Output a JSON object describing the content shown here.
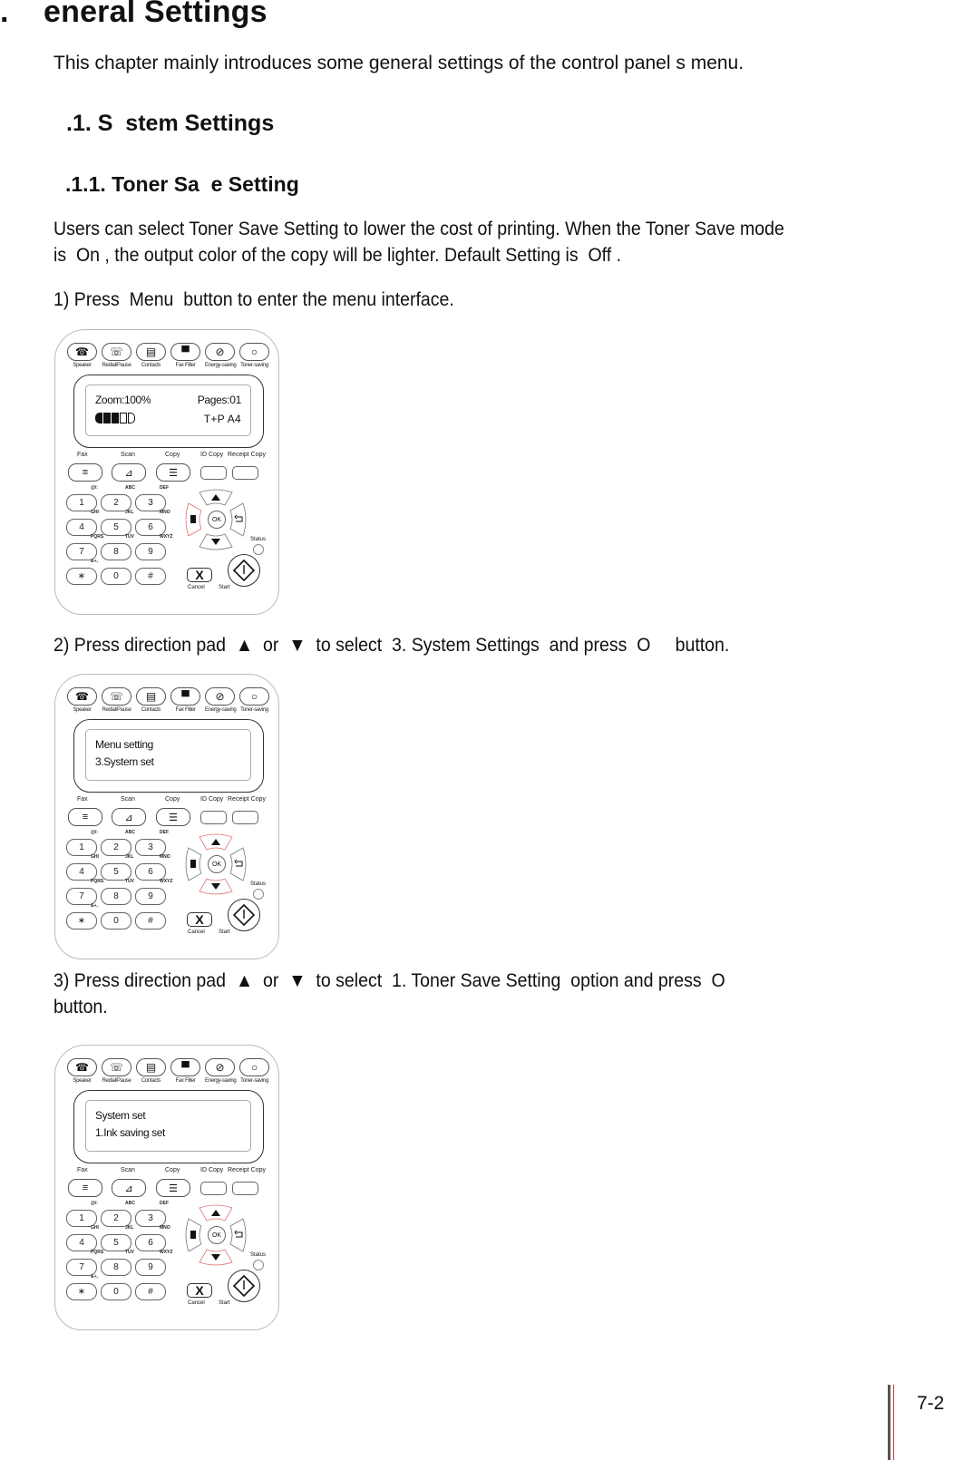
{
  "document": {
    "chapter_heading": {
      "number": ".",
      "title": "eneral Settings"
    },
    "intro": "This chapter mainly introduces some general settings of the control panel s menu.",
    "section_heading": ".1. S  stem Settings",
    "subsection_heading": ".1.1. Toner Sa  e Setting",
    "description": [
      "Users can select Toner Save Setting to lower the cost of printing. When the Toner Save mode",
      "is  On , the output color of the copy will be lighter. Default Setting is  Off ."
    ],
    "steps": [
      {
        "lines": [
          "1) Press  Menu  button to enter the menu interface."
        ]
      },
      {
        "lines": [
          "2) Press direction pad  ▲  or  ▼  to select  3. System Settings  and press  O     button."
        ]
      },
      {
        "lines": [
          "3) Press direction pad  ▲  or  ▼  to select  1. Toner Save Setting  option and press  O",
          "button."
        ]
      }
    ],
    "page_number": "7-2"
  },
  "panel_common": {
    "top_buttons": [
      {
        "label": "Speaker",
        "icon": "speaker-icon",
        "glyph": "☎"
      },
      {
        "label": "Redial/Pause",
        "icon": "redial-icon",
        "glyph": "☏"
      },
      {
        "label": "Contacts",
        "icon": "contacts-book-icon",
        "glyph": "▤"
      },
      {
        "label": "Fax Filter",
        "icon": "trash-icon",
        "glyph": "▀"
      },
      {
        "label": "Energy-saving",
        "icon": "energy-saving-icon",
        "glyph": "⊘"
      },
      {
        "label": "Toner-saving",
        "icon": "toner-saving-icon",
        "glyph": "○"
      }
    ],
    "mode_buttons": [
      {
        "label": "Fax",
        "icon": "fax-icon",
        "glyph": "≡"
      },
      {
        "label": "Scan",
        "icon": "scan-icon",
        "glyph": "⊿"
      },
      {
        "label": "Copy",
        "icon": "copy-icon",
        "glyph": "☰"
      }
    ],
    "id_copy_label": "ID Copy",
    "receipt_copy_label": "Receipt Copy",
    "keypad": [
      {
        "key": "1",
        "letters": "@/:"
      },
      {
        "key": "2",
        "letters": "ABC"
      },
      {
        "key": "3",
        "letters": "DEF"
      },
      {
        "key": "4",
        "letters": "GHI"
      },
      {
        "key": "5",
        "letters": "JKL"
      },
      {
        "key": "6",
        "letters": "MNO"
      },
      {
        "key": "7",
        "letters": "PQRS"
      },
      {
        "key": "8",
        "letters": "TUV"
      },
      {
        "key": "9",
        "letters": "WXYZ"
      },
      {
        "key": "∗",
        "letters": "&+,"
      },
      {
        "key": "0",
        "letters": ""
      },
      {
        "key": "#",
        "letters": ""
      }
    ],
    "ok_label": "OK",
    "status_label": "Status",
    "cancel_label": "Cancel",
    "cancel_glyph": "X",
    "start_label": "Start",
    "highlight_color": "#e07070"
  },
  "panels": [
    {
      "lcd": {
        "line1": "Zoom:100%",
        "right1": "Pages:01",
        "line2": "",
        "right2": "T+P   A4",
        "toner_level": {
          "filled": 3,
          "total": 5
        }
      },
      "highlight": "menu"
    },
    {
      "lcd": {
        "line1": "Menu setting",
        "right1": "",
        "line2": "3.System set",
        "right2": ""
      },
      "highlight": "up-down"
    },
    {
      "lcd": {
        "line1": "System set",
        "right1": "",
        "line2": "1.Ink saving set",
        "right2": ""
      },
      "highlight": "up-down"
    }
  ]
}
